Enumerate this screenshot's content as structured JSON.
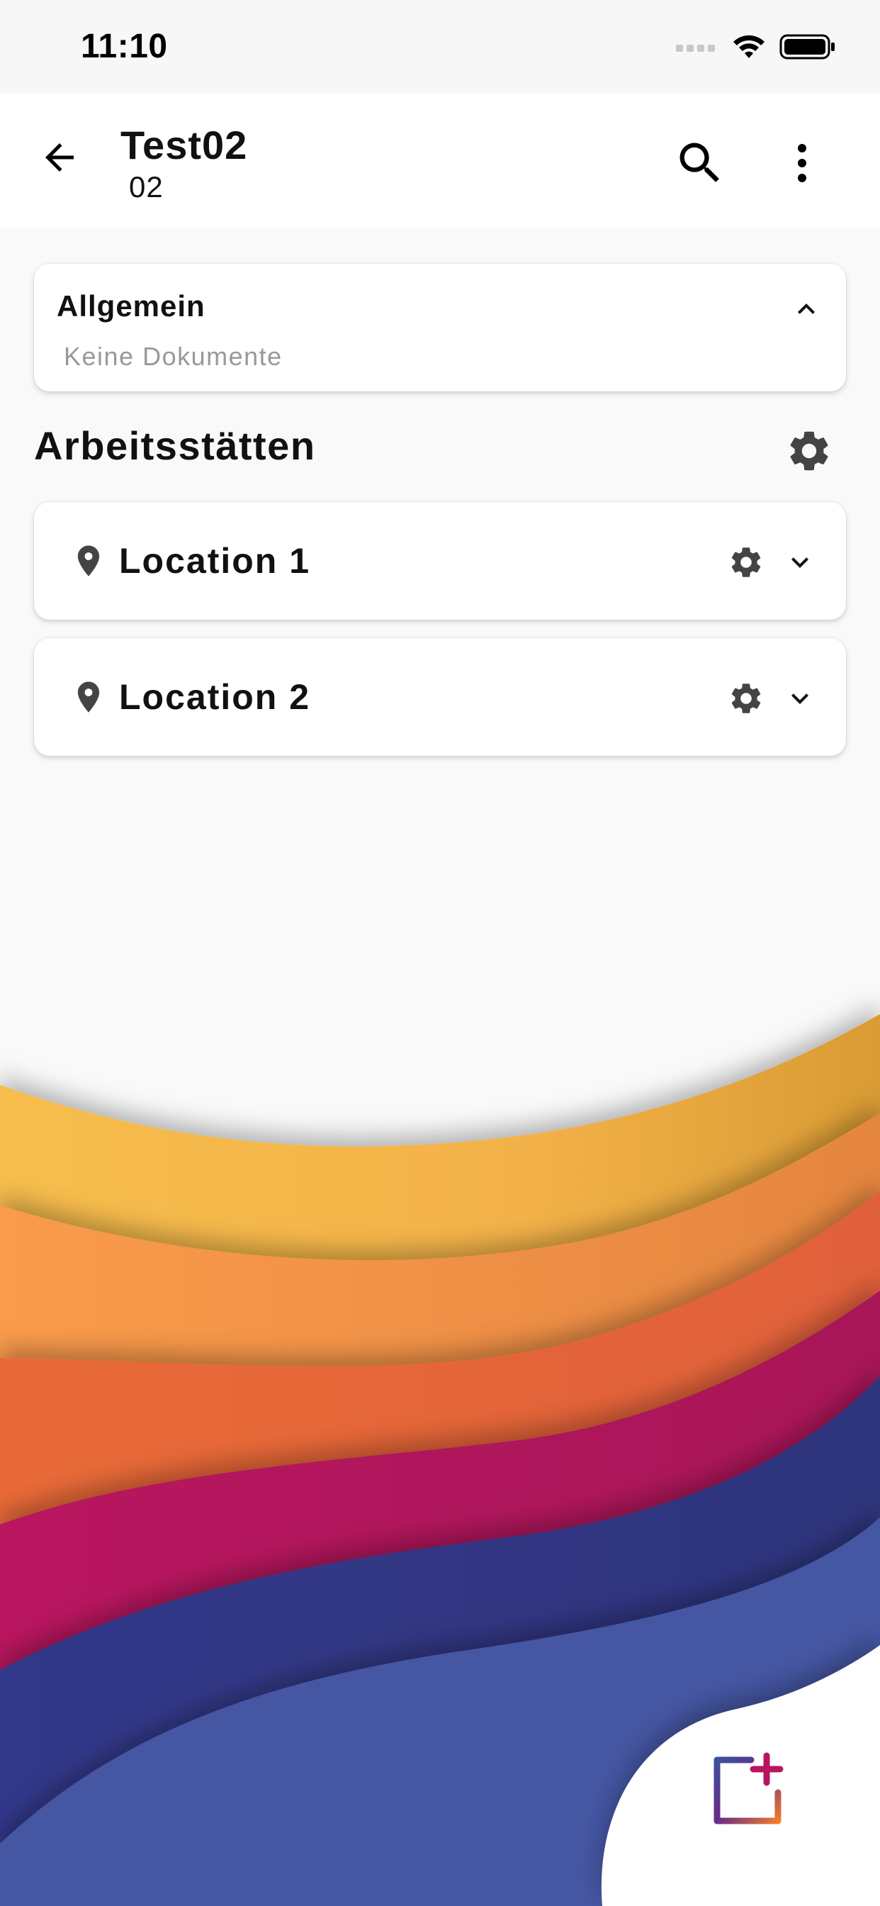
{
  "status_bar": {
    "time": "11:10"
  },
  "app_bar": {
    "title": "Test02",
    "subtitle": "02",
    "icons": [
      "back-arrow-icon",
      "search-icon",
      "more-vert-icon"
    ]
  },
  "general_section": {
    "title": "Allgemein",
    "empty_text": "Keine Dokumente",
    "expanded": true
  },
  "workplaces": {
    "title": "Arbeitsstätten",
    "items": [
      {
        "label": "Location 1"
      },
      {
        "label": "Location 2"
      }
    ]
  },
  "colors": {
    "wave_yellow": "#f5b94a",
    "wave_orange": "#f99a4d",
    "wave_red_orange": "#e86a3a",
    "wave_magenta": "#b8145e",
    "wave_dark_blue": "#2f3478",
    "wave_blue": "#4355a3",
    "icon_gray": "#444444"
  }
}
